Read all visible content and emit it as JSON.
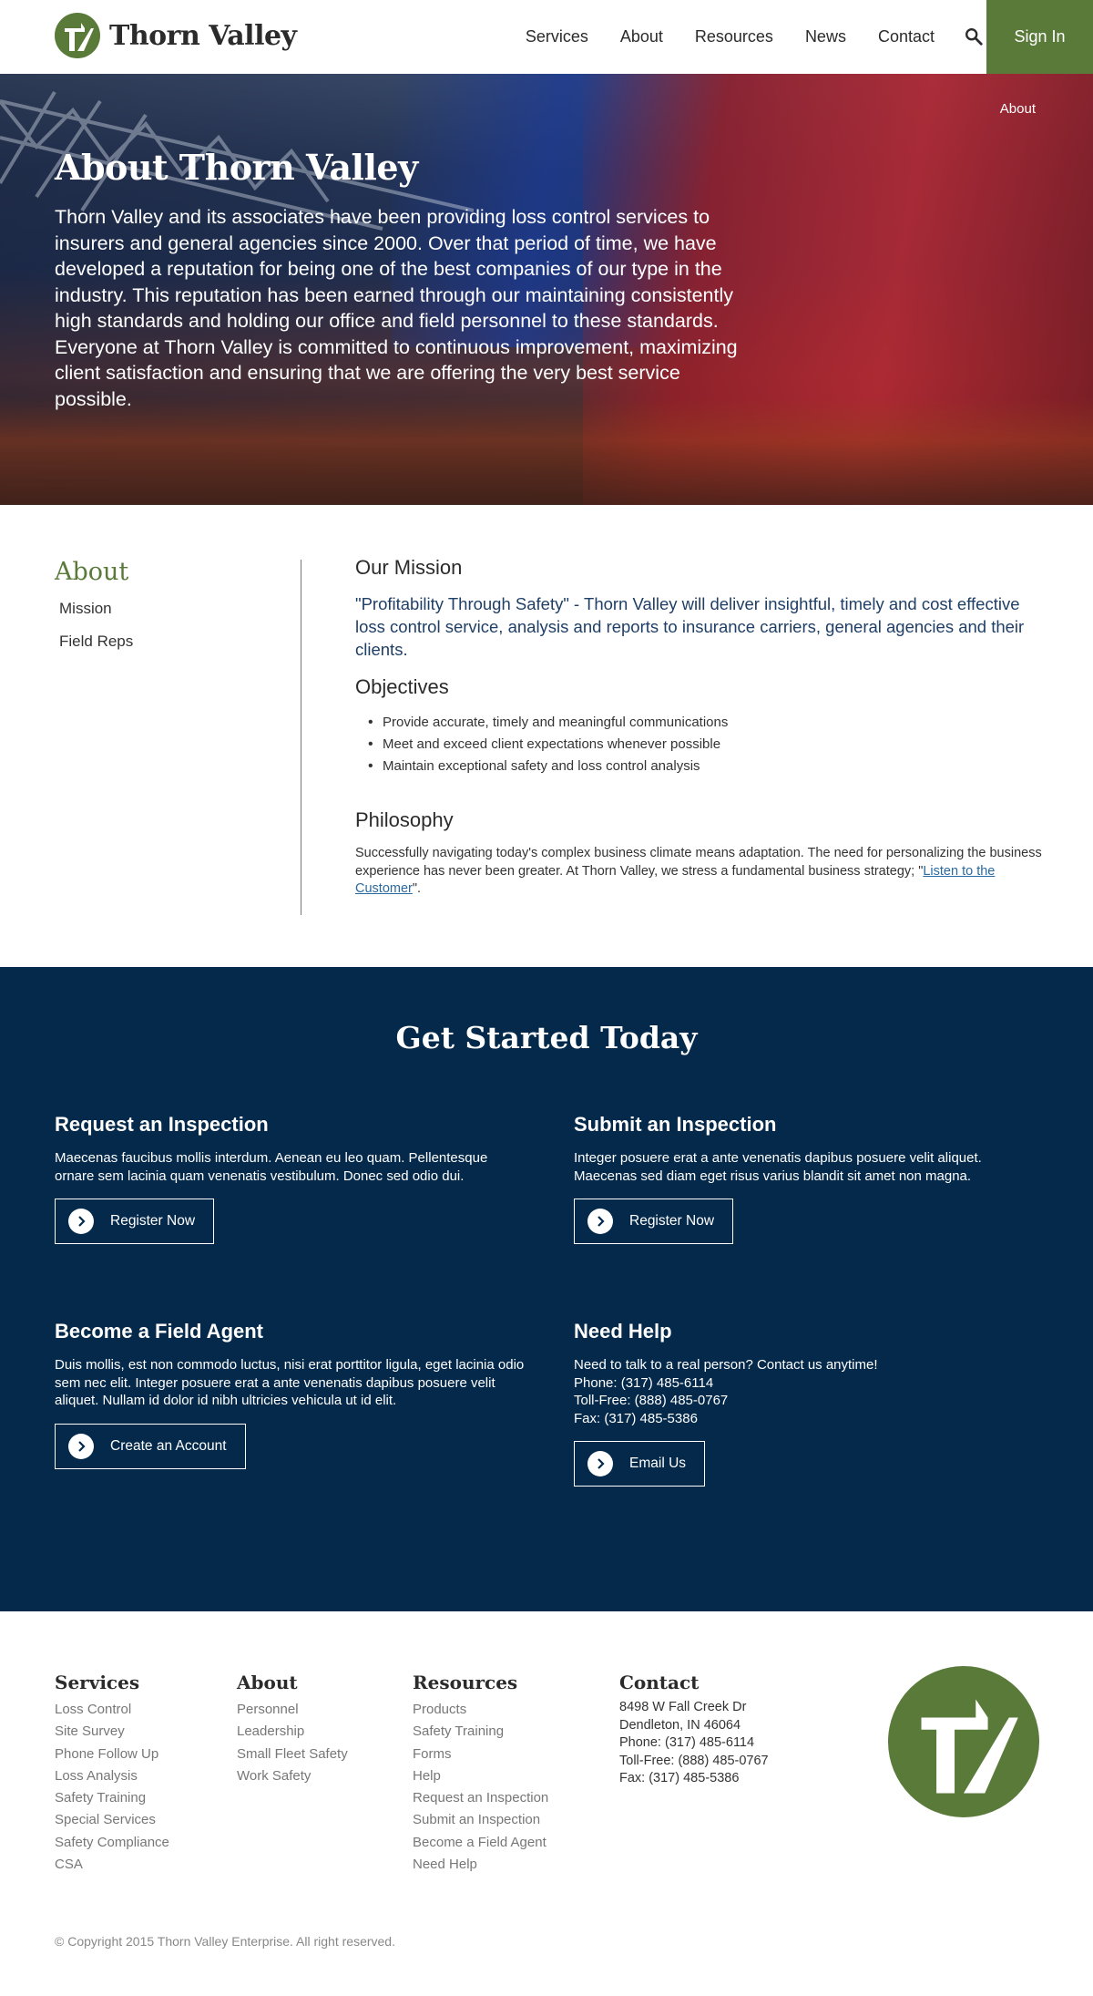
{
  "brand": {
    "name": "Thorn Valley",
    "accent": "#5a7a3a",
    "navy": "#04294a",
    "icon": "thorn-valley-logo-icon"
  },
  "nav": {
    "items": [
      "Services",
      "About",
      "Resources",
      "News",
      "Contact"
    ],
    "search_icon": "search-icon",
    "signin": "Sign In"
  },
  "hero": {
    "breadcrumb": "About",
    "title": "About Thorn Valley",
    "text": "Thorn Valley and its associates have been providing loss control services to insurers and general agencies since 2000. Over that period of time, we have developed a reputation for being one of the best companies of our type in the industry. This reputation has been earned through our maintaining consistently high standards and holding our office and field personnel to these standards. Everyone at Thorn Valley is committed to continuous improvement, maximizing client satisfaction and ensuring that we are offering the very best service possible."
  },
  "sidebar": {
    "title": "About",
    "items": [
      "Mission",
      "Field Reps"
    ]
  },
  "content": {
    "mission_title": "Our Mission",
    "mission_text": "\"Profitability Through Safety\" - Thorn Valley will deliver insightful, timely and cost effective loss control service, analysis and reports to insurance carriers, general agencies and their clients.",
    "objectives_title": "Objectives",
    "objectives": [
      "Provide accurate, timely and meaningful communications",
      "Meet and exceed client expectations whenever possible",
      "Maintain exceptional safety and loss control analysis"
    ],
    "philosophy_title": "Philosophy",
    "philosophy_text": "Successfully navigating today's complex business climate means adaptation. The need for personalizing the business experience has never been greater. At Thorn Valley, we stress a fundamental business strategy; \"",
    "philosophy_link": "Listen to the Customer",
    "philosophy_end": "\"."
  },
  "started": {
    "title": "Get Started Today",
    "cards": [
      {
        "title": "Request an Inspection",
        "text": "Maecenas faucibus mollis interdum. Aenean eu leo quam. Pellentesque ornare sem lacinia quam venenatis vestibulum. Donec sed odio dui.",
        "button": "Register Now"
      },
      {
        "title": "Submit an Inspection",
        "text": "Integer posuere erat a ante venenatis dapibus posuere velit aliquet. Maecenas sed diam eget risus varius blandit sit amet non magna.",
        "button": "Register Now"
      },
      {
        "title": "Become a Field Agent",
        "text": "Duis mollis, est non commodo luctus, nisi erat porttitor ligula, eget lacinia odio sem nec elit. Integer posuere erat a ante venenatis dapibus posuere velit aliquet. Nullam id dolor id nibh ultricies vehicula ut id elit.",
        "button": "Create an Account"
      },
      {
        "title": "Need Help",
        "text": "Need to talk to a real person? Contact us anytime!",
        "lines": [
          "Phone: (317) 485-6114",
          "Toll-Free: (888) 485-0767",
          "Fax: (317) 485-5386"
        ],
        "button": "Email Us"
      }
    ],
    "button_icon": "chevron-right-circle-icon"
  },
  "footer": {
    "columns": [
      {
        "title": "Services",
        "links": [
          "Loss Control",
          "Site Survey",
          "Phone Follow Up",
          "Loss Analysis",
          "Safety Training",
          "Special Services",
          "Safety Compliance",
          "CSA"
        ]
      },
      {
        "title": "About",
        "links": [
          "Personnel",
          "Leadership",
          "Small Fleet Safety",
          "Work Safety"
        ]
      },
      {
        "title": "Resources",
        "links": [
          "Products",
          "Safety Training",
          "Forms",
          "Help",
          "Request an Inspection",
          "Submit an Inspection",
          "Become a Field Agent",
          "Need Help"
        ]
      }
    ],
    "contact": {
      "title": "Contact",
      "lines": [
        "8498 W Fall Creek Dr",
        "Dendleton, IN 46064",
        "Phone: (317) 485-6114",
        "Toll-Free: (888) 485-0767",
        "Fax: (317) 485-5386"
      ]
    },
    "copyright": "© Copyright 2015 Thorn Valley Enterprise. All right reserved."
  }
}
